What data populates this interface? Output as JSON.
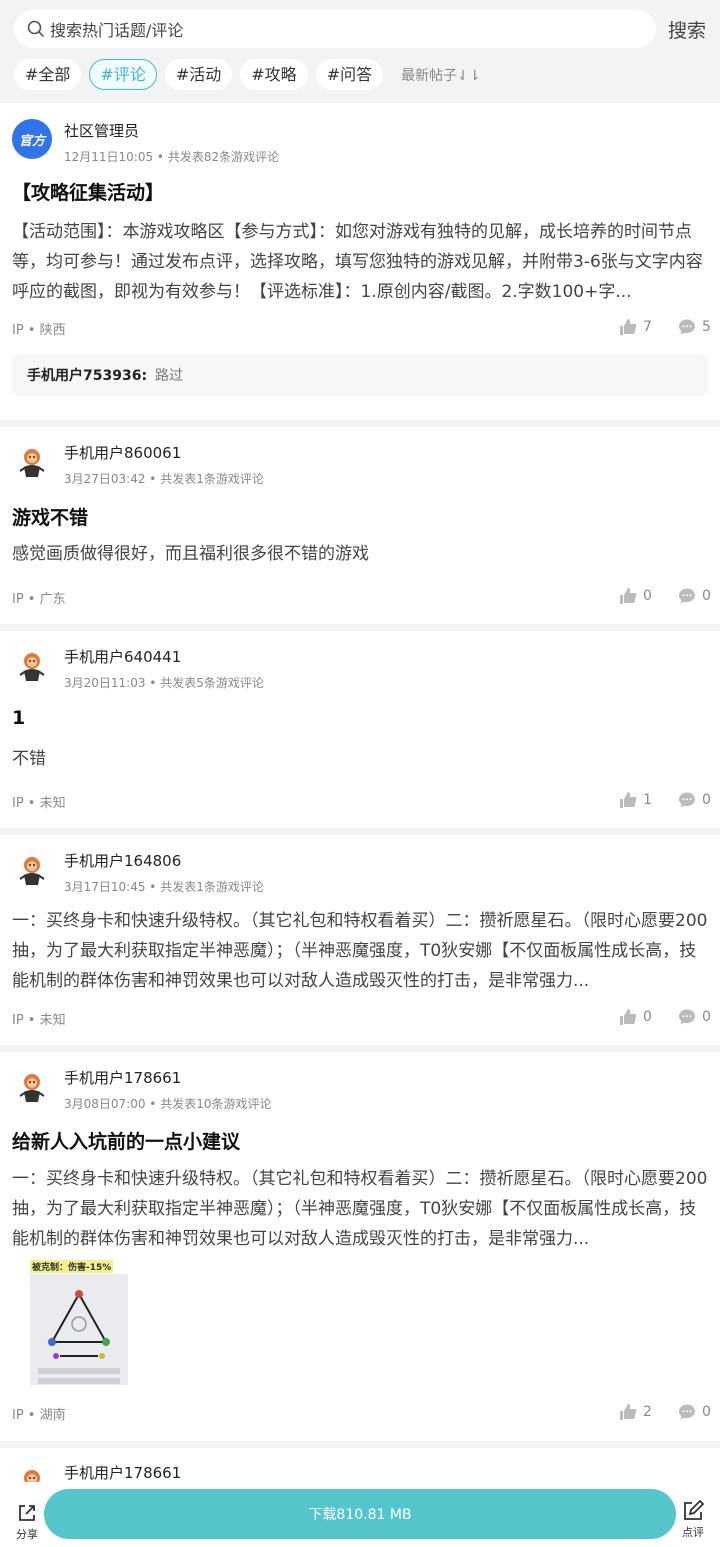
{
  "search": {
    "placeholder": "搜索热门话题/评论",
    "button": "搜索"
  },
  "tags": [
    "#全部",
    "#评论",
    "#活动",
    "#攻略",
    "#问答"
  ],
  "sort_label": "最新帖子⇃⇂",
  "posts": [
    {
      "avatar": "官方",
      "user": "社区管理员",
      "meta": "12月11日10:05 • 共发表82条游戏评论",
      "title": "【攻略征集活动】",
      "body": "【活动范围】：本游戏攻略区【参与方式】：如您对游戏有独特的见解，成长培养的时间节点等，均可参与！通过发布点评，选择攻略，填写您独特的游戏见解，并附带3-6张与文字内容呼应的截图，即视为有效参与！【评选标准】：1.原创内容/截图。2.字数100+字...",
      "ip": "IP • 陕西",
      "likes": "7",
      "comments": "5",
      "reply_user": "手机用户753936:",
      "reply_text": "路过"
    },
    {
      "user": "手机用户860061",
      "meta": "3月27日03:42 • 共发表1条游戏评论",
      "title": "游戏不错",
      "body": "感觉画质做得很好，而且福利很多很不错的游戏",
      "ip": "IP • 广东",
      "likes": "0",
      "comments": "0"
    },
    {
      "user": "手机用户640441",
      "meta": "3月20日11:03 • 共发表5条游戏评论",
      "title": "1",
      "body": "不错",
      "ip": "IP • 未知",
      "likes": "1",
      "comments": "0"
    },
    {
      "user": "手机用户164806",
      "meta": "3月17日10:45 • 共发表1条游戏评论",
      "body": "一：买终身卡和快速升级特权。（其它礼包和特权看着买）二：攒祈愿星石。（限时心愿要200抽，为了最大利获取指定半神恶魔）；（半神恶魔强度，T0狄安娜【不仅面板属性成长高，技能机制的群体伤害和神罚效果也可以对敌人造成毁灭性的打击，是非常强力...",
      "ip": "IP • 未知",
      "likes": "0",
      "comments": "0"
    },
    {
      "user": "手机用户178661",
      "meta": "3月08日07:00 • 共发表10条游戏评论",
      "title": "给新人入坑前的一点小建议",
      "body": "一：买终身卡和快速升级特权。（其它礼包和特权看着买）二：攒祈愿星石。（限时心愿要200抽，为了最大利获取指定半神恶魔）；（半神恶魔强度，T0狄安娜【不仅面板属性成长高，技能机制的群体伤害和神罚效果也可以对敌人造成毁灭性的打击，是非常强力...",
      "image_caption": "被克制：伤害-15%",
      "ip": "IP • 湖南",
      "likes": "2",
      "comments": "0"
    },
    {
      "user": "手机用户178661"
    }
  ],
  "bottom": {
    "share": "分享",
    "download": "下载810.81 MB",
    "review": "点评"
  },
  "colors": {
    "accent": "#55c5cc",
    "tag_active": "#3fb8c4",
    "official": "#2f74e8"
  }
}
